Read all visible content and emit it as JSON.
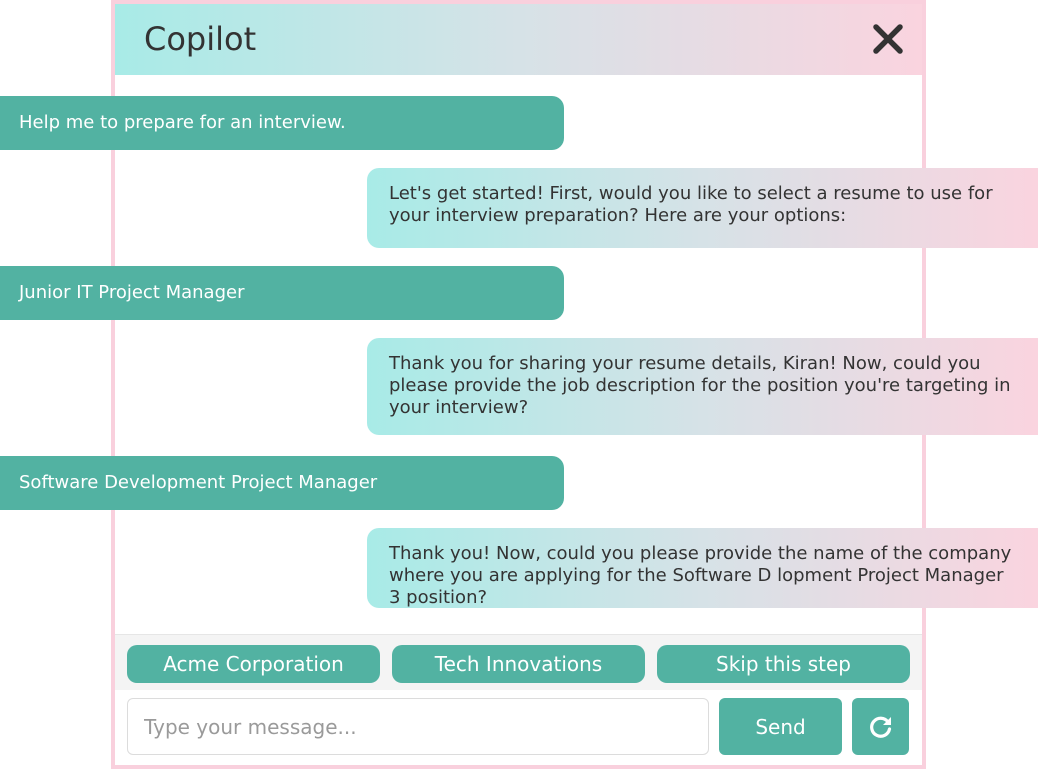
{
  "header": {
    "title": "Copilot",
    "close_icon": "close-icon"
  },
  "colors": {
    "accent": "#52b2a2",
    "gradient_start": "#a8ebe7",
    "gradient_end": "#fad4df",
    "border": "#f9d0dd"
  },
  "messages": [
    {
      "role": "user",
      "text": "Help me to prepare for an interview."
    },
    {
      "role": "bot",
      "text": "Let's get started! First, would you like to select a resume to use for your interview preparation? Here are your options:"
    },
    {
      "role": "user",
      "text": "Junior IT Project Manager"
    },
    {
      "role": "bot",
      "text": "Thank you for sharing your resume details, Kiran! Now, could you please provide the job description for the position you're targeting in your interview?"
    },
    {
      "role": "user",
      "text": "Software Development Project Manager"
    },
    {
      "role": "bot",
      "text": "Thank you! Now, could you please provide the name of the company where you are applying for the Software D lopment Project Manager 3 position?"
    }
  ],
  "quick_replies": [
    "Acme Corporation",
    "Tech Innovations",
    "Skip this step"
  ],
  "composer": {
    "placeholder": "Type your message...",
    "value": "",
    "send_label": "Send",
    "refresh_icon": "refresh-icon"
  }
}
